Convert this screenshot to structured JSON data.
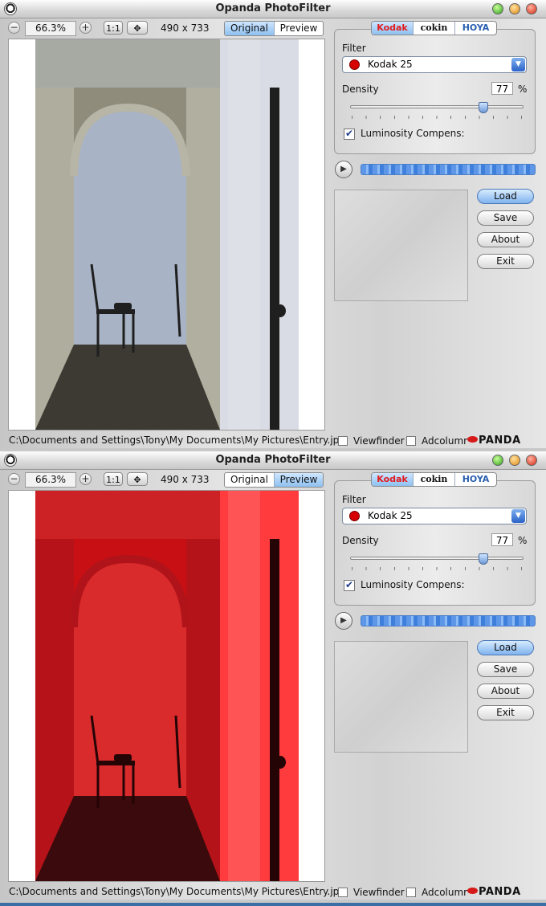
{
  "windows": [
    {
      "id": "original",
      "title": "Opanda PhotoFilter",
      "zoom": "66.3%",
      "ratio_label": "1:1",
      "dimensions": "490 x 733",
      "view_tabs": [
        "Original",
        "Preview"
      ],
      "active_view": "Original",
      "photo_variant": "normal",
      "brands": [
        "Kodak",
        "cokin",
        "HOYA"
      ],
      "active_brand": "Kodak",
      "filter_label": "Filter",
      "filter_value": "Kodak 25",
      "filter_color": "#d60000",
      "density_label": "Density",
      "density_value": "77",
      "density_unit": "%",
      "density_level": 0.77,
      "luminosity_label": "Luminosity Compens:",
      "luminosity_checked": true,
      "buttons": [
        "Load",
        "Save",
        "About",
        "Exit"
      ],
      "file_path": "C:\\Documents and Settings\\Tony\\My Documents\\My Pictures\\Entry.jpg",
      "viewfinder_label": "Viewfinder",
      "adcolumn_label": "Adcolumr",
      "logo_text": "PANDA"
    },
    {
      "id": "preview",
      "title": "Opanda PhotoFilter",
      "zoom": "66.3%",
      "ratio_label": "1:1",
      "dimensions": "490 x 733",
      "view_tabs": [
        "Original",
        "Preview"
      ],
      "active_view": "Preview",
      "photo_variant": "red",
      "brands": [
        "Kodak",
        "cokin",
        "HOYA"
      ],
      "active_brand": "Kodak",
      "filter_label": "Filter",
      "filter_value": "Kodak 25",
      "filter_color": "#d60000",
      "density_label": "Density",
      "density_value": "77",
      "density_unit": "%",
      "density_level": 0.77,
      "luminosity_label": "Luminosity Compens:",
      "luminosity_checked": true,
      "buttons": [
        "Load",
        "Save",
        "About",
        "Exit"
      ],
      "file_path": "C:\\Documents and Settings\\Tony\\My Documents\\My Pictures\\Entry.jpg",
      "viewfinder_label": "Viewfinder",
      "adcolumn_label": "Adcolumr",
      "logo_text": "PANDA"
    }
  ],
  "colors": {
    "accent_blue": "#8ec0f0",
    "kodak_red": "#e21b1b",
    "hoya_blue": "#2a5fb0",
    "filter_red": "#d60000"
  },
  "icons": {
    "zoom_out": "minus-icon",
    "zoom_in": "plus-icon",
    "fit": "move-arrows-icon",
    "play": "play-icon",
    "dropdown": "chevron-down-icon",
    "check": "check-icon"
  }
}
